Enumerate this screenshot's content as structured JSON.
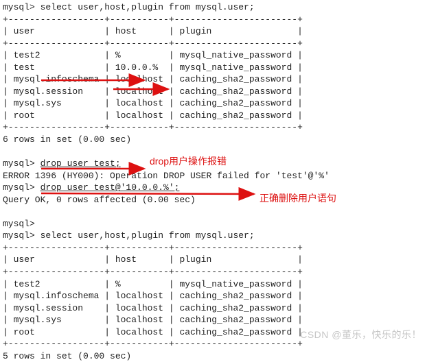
{
  "cmd1": "mysql> select user,host,plugin from mysql.user;",
  "sep_long": "+------------------+-----------+-----------------------+",
  "table1": {
    "header": "| user             | host      | plugin                |",
    "rows": [
      "| test2            | %         | mysql_native_password |",
      "| test             | 10.0.0.%  | mysql_native_password |",
      "| mysql.infoschema | localhost | caching_sha2_password |",
      "| mysql.session    | localhost | caching_sha2_password |",
      "| mysql.sys        | localhost | caching_sha2_password |",
      "| root             | localhost | caching_sha2_password |"
    ]
  },
  "result1": "6 rows in set (0.00 sec)",
  "drop_bad_cmd": "mysql> drop user test;",
  "drop_error": "ERROR 1396 (HY000): Operation DROP USER failed for 'test'@'%'",
  "drop_good_cmd": "mysql> drop user test@'10.0.0.%';",
  "drop_ok": "Query OK, 0 rows affected (0.00 sec)",
  "prompt_only": "mysql>",
  "cmd2": "mysql> select user,host,plugin from mysql.user;",
  "table2": {
    "header": "| user             | host      | plugin                |",
    "rows": [
      "| test2            | %         | mysql_native_password |",
      "| mysql.infoschema | localhost | caching_sha2_password |",
      "| mysql.session    | localhost | caching_sha2_password |",
      "| mysql.sys        | localhost | caching_sha2_password |",
      "| root             | localhost | caching_sha2_password |"
    ]
  },
  "result2": "5 rows in set (0.00 sec)",
  "labels": {
    "drop_fail": "drop用户操作报错",
    "drop_correct": "正确删除用户语句"
  },
  "watermark": "CSDN @董乐，快乐的乐！",
  "colors": {
    "accent": "#d11"
  }
}
